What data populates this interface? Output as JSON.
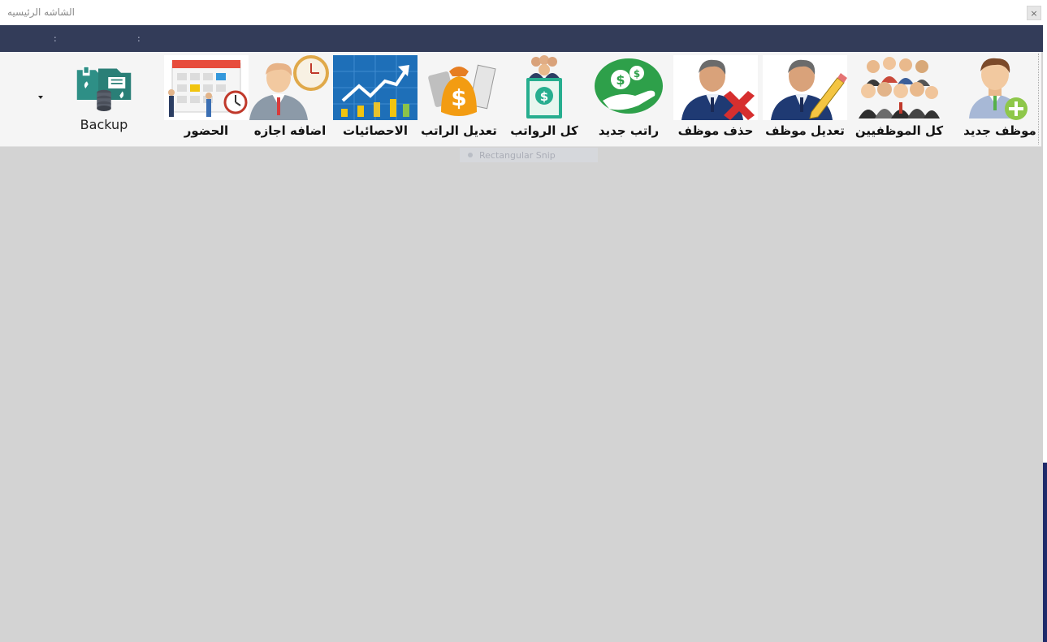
{
  "window": {
    "title": "الشاشه الرئيسيه",
    "close_label": "×"
  },
  "navbar": {
    "separators": [
      ":",
      ":"
    ]
  },
  "ribbon": {
    "items": [
      {
        "label": "موظف جديد",
        "icon": "add-employee-icon"
      },
      {
        "label": "كل الموظفيين",
        "icon": "employees-group-icon"
      },
      {
        "label": "تعديل موظف",
        "icon": "edit-employee-icon"
      },
      {
        "label": "حذف موظف",
        "icon": "delete-employee-icon"
      },
      {
        "label": "راتب جديد",
        "icon": "new-salary-icon"
      },
      {
        "label": "كل الرواتب",
        "icon": "all-salaries-icon"
      },
      {
        "label": "تعديل الراتب",
        "icon": "edit-salary-icon"
      },
      {
        "label": "الاحصائيات",
        "icon": "statistics-icon"
      },
      {
        "label": "اضافه اجازه",
        "icon": "add-vacation-icon"
      },
      {
        "label": "الحضور",
        "icon": "attendance-icon"
      },
      {
        "label": "Backup",
        "icon": "backup-icon"
      }
    ]
  },
  "overlay": {
    "ghost_label": "Rectangular Snip"
  },
  "colors": {
    "navbar": "#333c59",
    "workspace": "#d3d3d3",
    "ribbon": "#f5f5f5"
  }
}
